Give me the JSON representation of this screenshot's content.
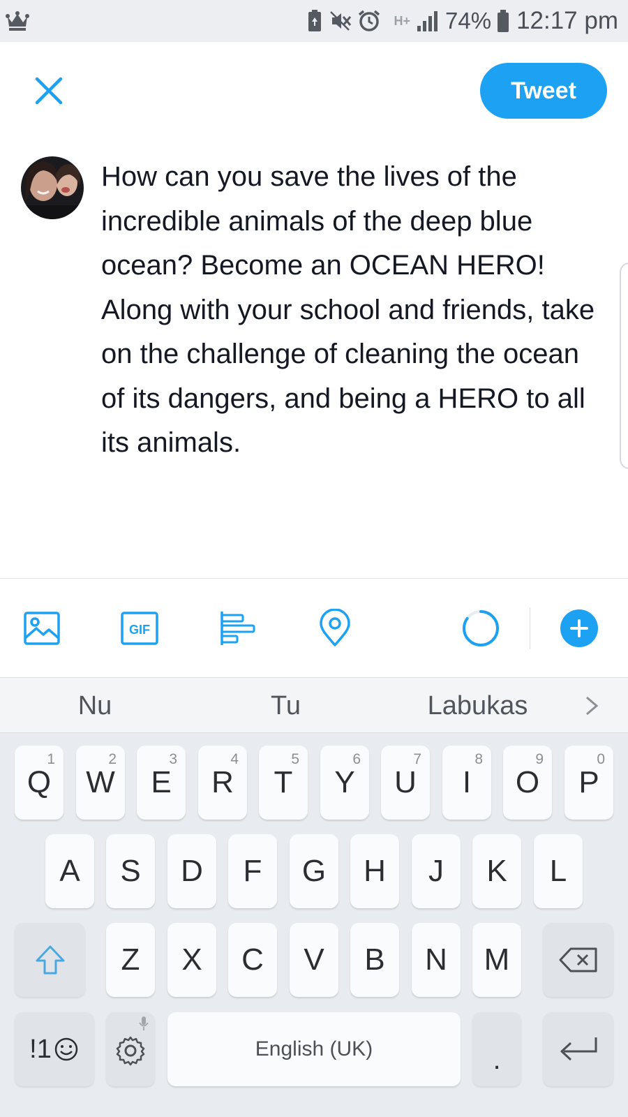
{
  "status_bar": {
    "network": "H+",
    "battery": "74%",
    "time": "12:17 pm"
  },
  "header": {
    "tweet_label": "Tweet"
  },
  "composer": {
    "text": "How can you save the lives of the incredible animals of the deep blue ocean? Become an OCEAN HERO! Along with your school and friends, take on the challenge of cleaning the ocean of its dangers, and being a HERO to all its animals."
  },
  "toolbar": {
    "gif_label": "GIF"
  },
  "suggestions": [
    "Nu",
    "Tu",
    "Labukas"
  ],
  "keyboard": {
    "row1": [
      {
        "key": "Q",
        "hint": "1"
      },
      {
        "key": "W",
        "hint": "2"
      },
      {
        "key": "E",
        "hint": "3"
      },
      {
        "key": "R",
        "hint": "4"
      },
      {
        "key": "T",
        "hint": "5"
      },
      {
        "key": "Y",
        "hint": "6"
      },
      {
        "key": "U",
        "hint": "7"
      },
      {
        "key": "I",
        "hint": "8"
      },
      {
        "key": "O",
        "hint": "9"
      },
      {
        "key": "P",
        "hint": "0"
      }
    ],
    "row2": [
      "A",
      "S",
      "D",
      "F",
      "G",
      "H",
      "J",
      "K",
      "L"
    ],
    "row3": [
      "Z",
      "X",
      "C",
      "V",
      "B",
      "N",
      "M"
    ],
    "symbols_label": "!1",
    "space_label": "English (UK)",
    "period_label": "."
  },
  "colors": {
    "accent": "#1da1f2",
    "status_bar_bg": "#eceef1",
    "keyboard_bg": "#e8ebef"
  }
}
